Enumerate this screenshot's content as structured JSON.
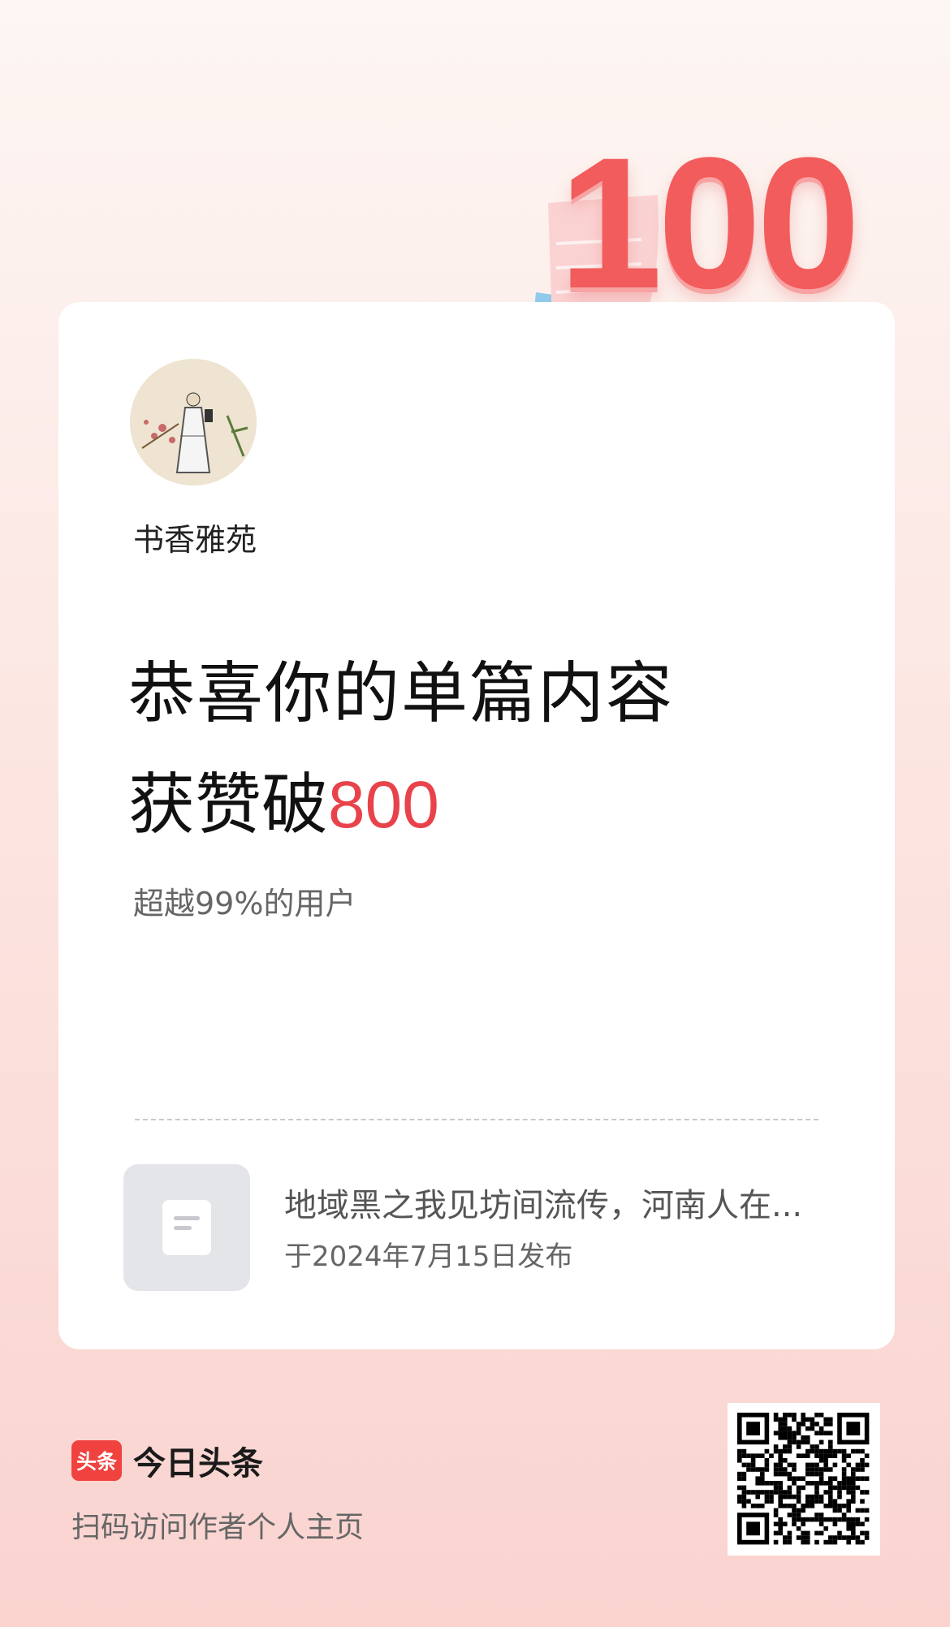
{
  "badge": {
    "number": "100"
  },
  "author": {
    "name": "书香雅苑"
  },
  "headline": {
    "line1": "恭喜你的单篇内容",
    "line2_prefix": "获赞破",
    "line2_number": "800"
  },
  "subtitle": "超越99%的用户",
  "article": {
    "title": "地域黑之我见坊间流传，河南人在...",
    "date": "于2024年7月15日发布"
  },
  "footer": {
    "brand_logo_text": "头条",
    "brand_name": "今日头条",
    "scan_text": "扫码访问作者个人主页"
  },
  "colors": {
    "accent": "#e8434a",
    "brand": "#f0423e"
  },
  "icons": {
    "thumbnail": "document-icon",
    "badge_heart": "heart-icon"
  }
}
